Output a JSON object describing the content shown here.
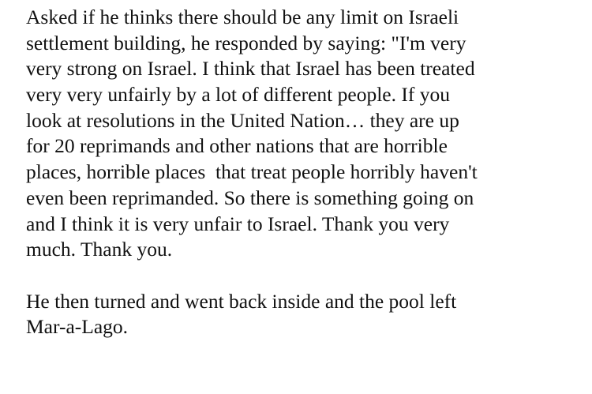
{
  "paragraphs": [
    {
      "lines": [
        "Asked if he thinks there should be any limit on Israeli",
        "settlement building, he responded by saying: \"I'm very",
        "very strong on Israel. I think that Israel has been treated",
        "very very unfairly by a lot of different people. If you",
        "look at resolutions in the United Nation… they are up",
        "for 20 reprimands and other nations that are horrible",
        "places, horrible places  that treat people horribly haven't",
        "even been reprimanded. So there is something going on",
        "and I think it is very unfair to Israel. Thank you very",
        "much. Thank you."
      ]
    },
    {
      "lines": [
        "He then turned and went back inside and the pool left",
        "Mar-a-Lago."
      ]
    }
  ]
}
